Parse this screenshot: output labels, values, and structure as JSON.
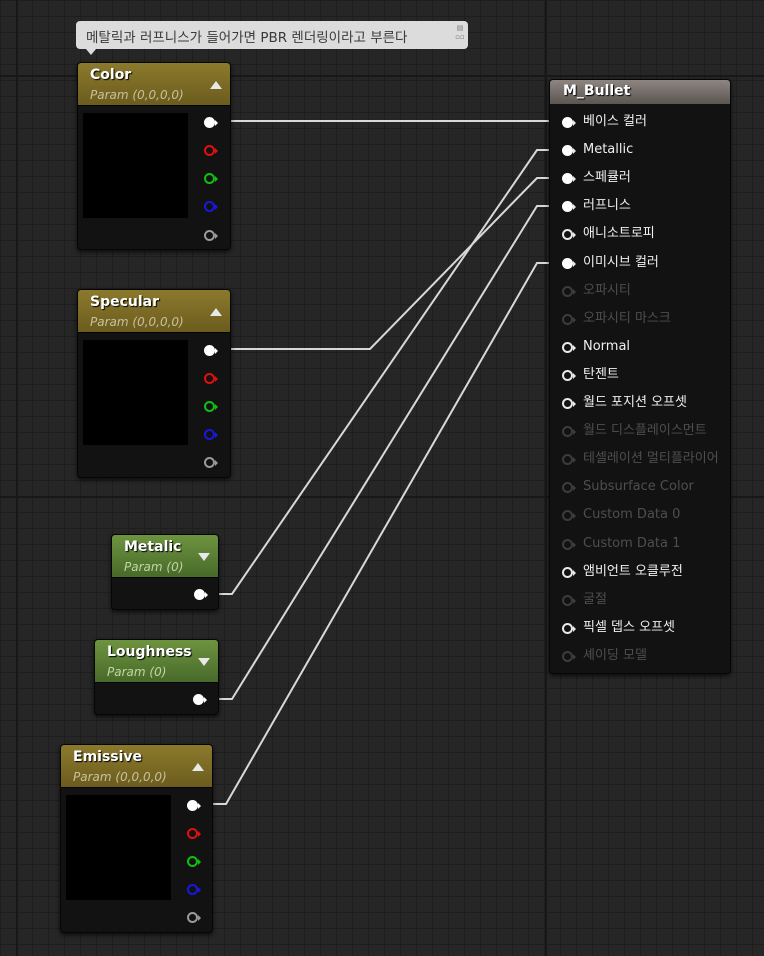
{
  "comment": {
    "text": "메탈릭과 러프니스가 들어가면 PBR 렌더링이라고 부른다",
    "icon": "comment-bubble-icon"
  },
  "param_nodes": [
    {
      "title": "Color",
      "subtitle": "Param (0,0,0,0)",
      "kind": "vector"
    },
    {
      "title": "Specular",
      "subtitle": "Param (0,0,0,0)",
      "kind": "vector"
    },
    {
      "title": "Metalic",
      "subtitle": "Param (0)",
      "kind": "scalar"
    },
    {
      "title": "Loughness",
      "subtitle": "Param (0)",
      "kind": "scalar"
    },
    {
      "title": "Emissive",
      "subtitle": "Param (0,0,0,0)",
      "kind": "vector"
    }
  ],
  "pin_colors": {
    "rgba": "#ffffff",
    "r": "#e01010",
    "g": "#10c010",
    "b": "#1818e0",
    "a": "#9a9a9a"
  },
  "material_node": {
    "title": "M_Bullet",
    "inputs": [
      {
        "label": "베이스 컬러",
        "state": "connected"
      },
      {
        "label": "Metallic",
        "state": "connected"
      },
      {
        "label": "스페큘러",
        "state": "connected"
      },
      {
        "label": "러프니스",
        "state": "connected"
      },
      {
        "label": "애니소트로피",
        "state": "enabled"
      },
      {
        "label": "이미시브 컬러",
        "state": "connected"
      },
      {
        "label": "오파시티",
        "state": "disabled"
      },
      {
        "label": "오파시티 마스크",
        "state": "disabled"
      },
      {
        "label": "Normal",
        "state": "enabled"
      },
      {
        "label": "탄젠트",
        "state": "enabled"
      },
      {
        "label": "월드 포지션 오프셋",
        "state": "enabled"
      },
      {
        "label": "월드 디스플레이스먼트",
        "state": "disabled"
      },
      {
        "label": "테셀레이션 멀티플라이어",
        "state": "disabled"
      },
      {
        "label": "Subsurface Color",
        "state": "disabled"
      },
      {
        "label": "Custom Data 0",
        "state": "disabled"
      },
      {
        "label": "Custom Data 1",
        "state": "disabled"
      },
      {
        "label": "앰비언트 오클루전",
        "state": "enabled"
      },
      {
        "label": "굴절",
        "state": "disabled"
      },
      {
        "label": "픽셀 뎁스 오프셋",
        "state": "enabled"
      },
      {
        "label": "셰이딩 모델",
        "state": "disabled"
      }
    ]
  },
  "connections": [
    {
      "from": "Color",
      "to": "베이스 컬러"
    },
    {
      "from": "Specular",
      "to": "스페큘러"
    },
    {
      "from": "Metalic",
      "to": "Metallic"
    },
    {
      "from": "Loughness",
      "to": "러프니스"
    },
    {
      "from": "Emissive",
      "to": "이미시브 컬러"
    }
  ]
}
